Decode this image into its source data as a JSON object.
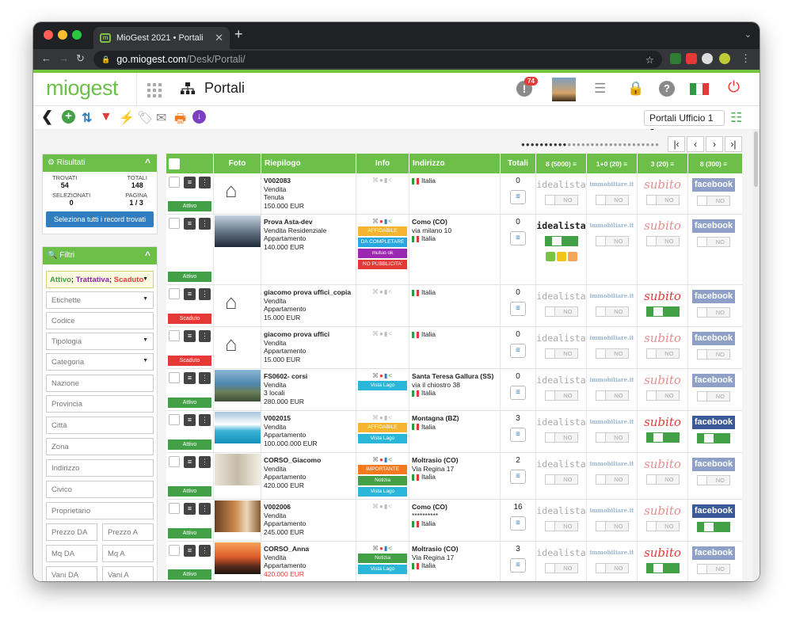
{
  "browser": {
    "tab_title": "MioGest 2021 • Portali",
    "url_domain": "go.miogest.com",
    "url_path": "/Desk/Portali/",
    "tab_close": "✕",
    "new_tab": "+",
    "menu_caret": "⌄"
  },
  "app": {
    "logo": "miogest",
    "page_title": "Portali",
    "notifications_count": "74",
    "brand_color": "#6cc04a"
  },
  "toolbar": {
    "portal_select": "Portali Ufficio 1"
  },
  "pager": {
    "first": "⏮",
    "prev": "‹",
    "next": "›",
    "last": "⏭"
  },
  "results_panel": {
    "title": "Risultati",
    "trovati_label": "TROVATI",
    "trovati": "54",
    "totali_label": "TOTALI",
    "totali": "148",
    "selezionati_label": "SELEZIONATI",
    "selezionati": "0",
    "pagina_label": "PAGINA",
    "pagina": "1 / 3",
    "select_all_button": "Seleziona tutti i record trovati"
  },
  "filters_panel": {
    "title": "Filtri",
    "status_attivo": "Attivo",
    "status_trattativa": "Trattativa",
    "status_scaduto": "Scaduto",
    "etichette": "Etichette",
    "codice": "Codice",
    "tipologia": "Tipologia",
    "categoria": "Categoria",
    "nazione": "Nazione",
    "provincia": "Provincia",
    "citta": "Città",
    "zona": "Zona",
    "indirizzo": "Indirizzo",
    "civico": "Civico",
    "proprietario": "Proprietario",
    "prezzo_da": "Prezzo DA",
    "prezzo_a": "Prezzo A",
    "mq_da": "Mq DA",
    "mq_a": "Mq A",
    "vani_da": "Vani DA",
    "vani_a": "Vani A"
  },
  "table": {
    "headers": {
      "foto": "Foto",
      "riepilogo": "Riepilogo",
      "info": "Info",
      "indirizzo": "Indirizzo",
      "totali": "Totali",
      "p1": "8 (5000) ≡",
      "p2": "1+0 (20) ≡",
      "p3": "3 (20) ≡",
      "p4": "8 (300) ≡"
    },
    "portal_logos": {
      "idealista": "idealista",
      "immobiliare": "immobiliare.it",
      "subito": "subito",
      "facebook": "facebook"
    },
    "toggle_no": "NO",
    "toggle_si": "SI",
    "rows": [
      {
        "status": "Attivo",
        "status_color": "#43a047",
        "photo": "house",
        "code": "V002083",
        "line1": "Vendita",
        "line2": "Tenuta",
        "price": "150.000 EUR",
        "price_red": false,
        "icons": "grey",
        "tags": [],
        "addr_title": "",
        "addr_l1": "",
        "addr_l2": "Italia",
        "total": "0",
        "p": [
          "no",
          "no",
          "no",
          "no"
        ],
        "idea_on": false,
        "sub_on": false,
        "fb_on": false,
        "extra": false
      },
      {
        "status": "Attivo",
        "status_color": "#43a047",
        "photo": "city",
        "code": "Prova Asta-dev",
        "line1": "Vendita Residenziale",
        "line2": "Appartamento",
        "price": "140.000 EUR",
        "price_red": false,
        "icons": "color",
        "tags": [
          {
            "t": "AFFIDABILE",
            "c": "#f6b531"
          },
          {
            "t": "DA COMPLETARE",
            "c": "#29a8e0"
          },
          {
            "t": "mutuo ok",
            "c": "#9c27b0"
          },
          {
            "t": "NO PUBBLICITA'",
            "c": "#e53935"
          }
        ],
        "addr_title": "Como (CO)",
        "addr_l1": "via milano 10",
        "addr_l2": "Italia",
        "total": "0",
        "p": [
          "si",
          "no",
          "no",
          "no"
        ],
        "idea_on": true,
        "sub_on": false,
        "fb_on": false,
        "extra": true
      },
      {
        "status": "Scaduto",
        "status_color": "#e53935",
        "photo": "house",
        "code": "giacomo prova uffici_copia",
        "line1": "Vendita",
        "line2": "Appartamento",
        "price": "15.000 EUR",
        "price_red": false,
        "icons": "grey",
        "tags": [],
        "addr_title": "",
        "addr_l1": "",
        "addr_l2": "Italia",
        "total": "0",
        "p": [
          "no",
          "no",
          "si",
          "no"
        ],
        "idea_on": false,
        "sub_on": true,
        "fb_on": false,
        "extra": false
      },
      {
        "status": "Scaduto",
        "status_color": "#e53935",
        "photo": "house",
        "code": "giacomo prova uffici",
        "line1": "Vendita",
        "line2": "Appartamento",
        "price": "15.000 EUR",
        "price_red": false,
        "icons": "grey",
        "tags": [],
        "addr_title": "",
        "addr_l1": "",
        "addr_l2": "Italia",
        "total": "0",
        "p": [
          "no",
          "no",
          "no",
          "no"
        ],
        "idea_on": false,
        "sub_on": false,
        "fb_on": false,
        "extra": false
      },
      {
        "status": "Attivo",
        "status_color": "#43a047",
        "photo": "sea",
        "code": "FS0602- corsi",
        "line1": "Vendita",
        "line2": "3 locali",
        "price": "280.000 EUR",
        "price_red": false,
        "icons": "color",
        "tags": [
          {
            "t": "Vista Lago",
            "c": "#29b6d8"
          }
        ],
        "addr_title": "Santa Teresa Gallura (SS)",
        "addr_l1": "via il chiostro 38",
        "addr_l2": "Italia",
        "total": "0",
        "p": [
          "no",
          "no",
          "no",
          "no"
        ],
        "idea_on": false,
        "sub_on": false,
        "fb_on": false,
        "extra": false
      },
      {
        "status": "Attivo",
        "status_color": "#43a047",
        "photo": "pool",
        "code": "V002015",
        "line1": "Vendita",
        "line2": "Appartamento",
        "price": "100.000.000 EUR",
        "price_red": false,
        "icons": "grey",
        "tags": [
          {
            "t": "AFFIDABILE",
            "c": "#f6b531"
          },
          {
            "t": "Vista Lago",
            "c": "#29b6d8"
          }
        ],
        "addr_title": "Montagna (BZ)",
        "addr_l1": "",
        "addr_l2": "Italia",
        "total": "3",
        "p": [
          "no",
          "no",
          "si",
          "si"
        ],
        "idea_on": false,
        "sub_on": true,
        "fb_on": true,
        "extra": false
      },
      {
        "status": "Attivo",
        "status_color": "#43a047",
        "photo": "room",
        "code": "CORSO_Giacomo",
        "line1": "Vendita",
        "line2": "Appartamento",
        "price": "420.000 EUR",
        "price_red": false,
        "icons": "color",
        "tags": [
          {
            "t": "IMPORTANTE",
            "c": "#f5791f"
          },
          {
            "t": "Notizia",
            "c": "#43a047"
          },
          {
            "t": "Vista Lago",
            "c": "#29b6d8"
          }
        ],
        "addr_title": "Moltrasio (CO)",
        "addr_l1": "Via Regina 17",
        "addr_l2": "Italia",
        "total": "2",
        "p": [
          "no",
          "no",
          "no",
          "no"
        ],
        "idea_on": false,
        "sub_on": false,
        "fb_on": false,
        "extra": false
      },
      {
        "status": "Attivo",
        "status_color": "#43a047",
        "photo": "living",
        "code": "V002006",
        "line1": "Vendita",
        "line2": "Appartamento",
        "price": "245.000 EUR",
        "price_red": false,
        "icons": "grey",
        "tags": [],
        "addr_title": "Como (CO)",
        "addr_l1": "**********",
        "addr_l2": "Italia",
        "total": "16",
        "p": [
          "no",
          "no",
          "no",
          "si"
        ],
        "idea_on": false,
        "sub_on": false,
        "fb_on": true,
        "extra": false
      },
      {
        "status": "Attivo",
        "status_color": "#43a047",
        "photo": "sunset",
        "code": "CORSO_Anna",
        "line1": "Vendita",
        "line2": "Appartamento",
        "price": "420.000 EUR",
        "price_red": true,
        "icons": "color",
        "tags": [
          {
            "t": "Notizia",
            "c": "#43a047"
          },
          {
            "t": "Vista Lago",
            "c": "#29b6d8"
          }
        ],
        "addr_title": "Moltrasio (CO)",
        "addr_l1": "Via Regina 17",
        "addr_l2": "Italia",
        "total": "3",
        "p": [
          "no",
          "no",
          "si",
          "no"
        ],
        "idea_on": false,
        "sub_on": true,
        "fb_on": false,
        "extra": false
      }
    ]
  }
}
